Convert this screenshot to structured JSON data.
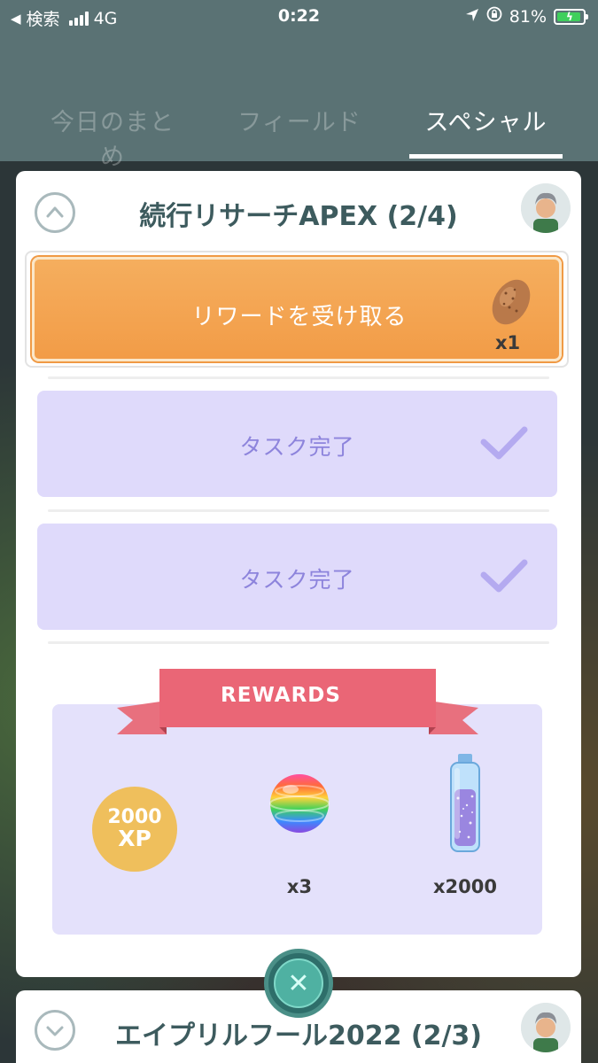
{
  "status_bar": {
    "back_label": "検索",
    "network": "4G",
    "time": "0:22",
    "battery_percent": "81%"
  },
  "tabs": [
    {
      "label": "今日のまとめ",
      "active": false
    },
    {
      "label": "フィールド",
      "active": false
    },
    {
      "label": "スペシャル",
      "active": true
    }
  ],
  "research_card": {
    "title": "続行リサーチAPEX (2/4)",
    "claim_button": {
      "label": "リワードを受け取る",
      "quantity": "x1",
      "item_icon": "pokeball-icon"
    },
    "tasks": [
      {
        "label": "タスク完了",
        "completed": true
      },
      {
        "label": "タスク完了",
        "completed": true
      }
    ],
    "rewards": {
      "header": "REWARDS",
      "items": [
        {
          "icon": "xp-icon",
          "amount_top": "2000",
          "amount_bottom": "XP",
          "quantity": ""
        },
        {
          "icon": "rare-candy-icon",
          "quantity": "x3"
        },
        {
          "icon": "stardust-icon",
          "quantity": "x2000"
        }
      ]
    }
  },
  "next_card": {
    "title": "エイプリルフール2022 (2/3)"
  },
  "colors": {
    "header_bg": "#5a7274",
    "claim_orange": "#f29c47",
    "task_lavender": "#dfdafb",
    "ribbon_pink": "#ea6676",
    "close_teal": "#4fb1a2"
  }
}
